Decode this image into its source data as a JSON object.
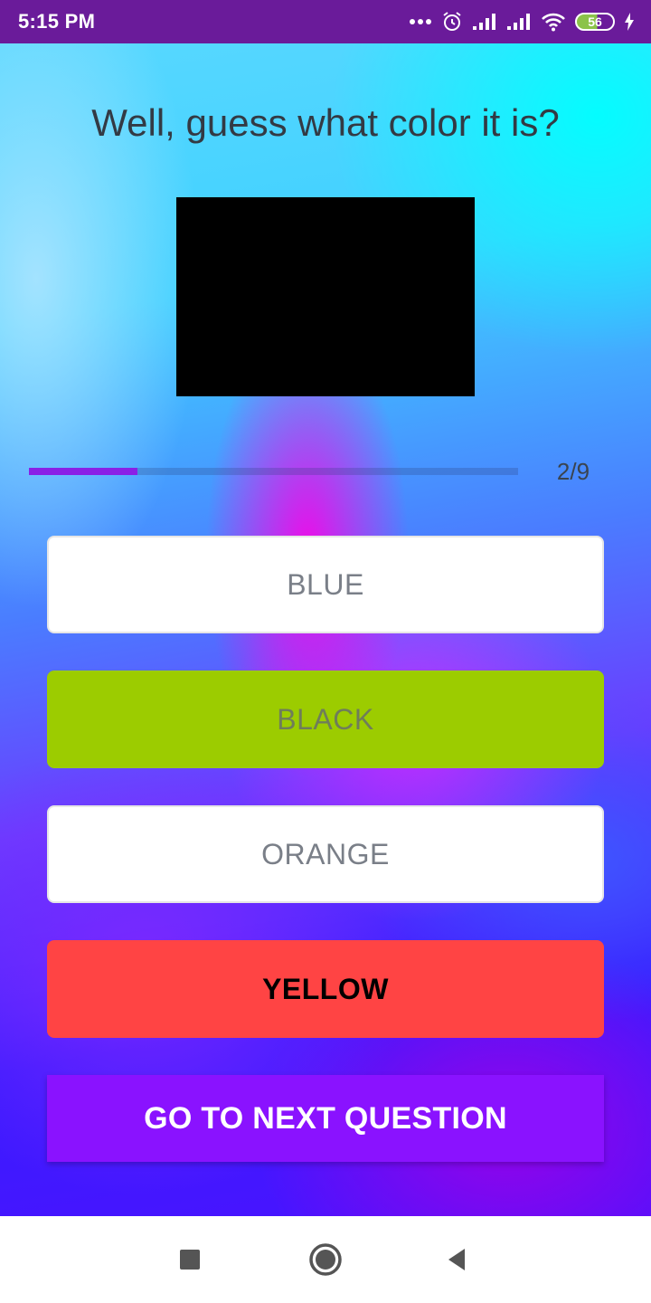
{
  "status_bar": {
    "time": "5:15 PM",
    "battery_level": "56",
    "icons": [
      "more-dots-icon",
      "alarm-icon",
      "signal-icon",
      "signal-icon",
      "wifi-icon",
      "battery-icon",
      "charging-icon"
    ]
  },
  "quiz": {
    "question": "Well, guess what color it is?",
    "swatch_color": "#000000",
    "progress": {
      "current": 2,
      "total": 9,
      "label": "2/9",
      "fraction": 0.222
    },
    "answers": [
      {
        "label": "BLUE",
        "state": "default"
      },
      {
        "label": "BLACK",
        "state": "correct",
        "color": "#9ccc00"
      },
      {
        "label": "ORANGE",
        "state": "default"
      },
      {
        "label": "YELLOW",
        "state": "wrong-selected",
        "color": "#ff4444"
      }
    ],
    "next_button_label": "GO TO NEXT QUESTION"
  },
  "colors": {
    "status_bar": "#6a1b9a",
    "progress_fill": "#8a20e6",
    "next_button": "#8a12ff"
  },
  "nav_bar": {
    "icons": [
      "recents-square-icon",
      "home-circle-icon",
      "back-triangle-icon"
    ]
  }
}
